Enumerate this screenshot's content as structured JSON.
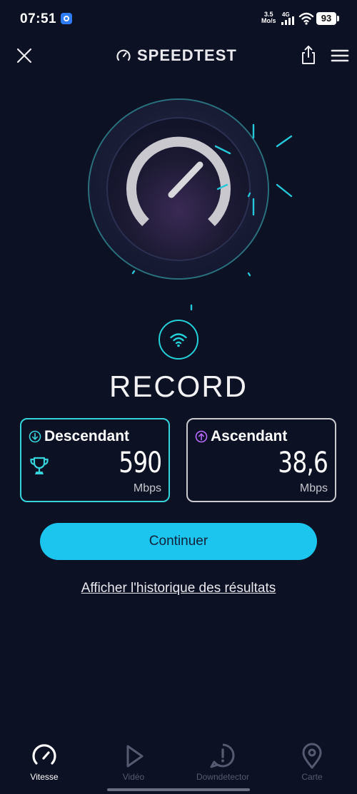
{
  "status_bar": {
    "time": "07:51",
    "net_speed_value": "3.5",
    "net_speed_unit": "Mo/s",
    "network": "4G",
    "battery": "93"
  },
  "header": {
    "title": "SPEEDTEST",
    "close_icon": "close-icon",
    "share_icon": "share-icon",
    "menu_icon": "menu-icon"
  },
  "result": {
    "title": "RECORD",
    "download": {
      "label": "Descendant",
      "value": "590",
      "unit": "Mbps",
      "color": "#35d4da"
    },
    "upload": {
      "label": "Ascendant",
      "value": "38,6",
      "unit": "Mbps",
      "color": "#b86bff"
    }
  },
  "actions": {
    "continue_label": "Continuer",
    "history_label": "Afficher l'historique des résultats"
  },
  "bottom_nav": {
    "items": [
      {
        "label": "Vitesse",
        "icon": "speedometer-icon",
        "active": true
      },
      {
        "label": "Vidéo",
        "icon": "play-icon",
        "active": false
      },
      {
        "label": "Downdetector",
        "icon": "alert-icon",
        "active": false
      },
      {
        "label": "Carte",
        "icon": "map-pin-icon",
        "active": false
      }
    ]
  },
  "colors": {
    "background": "#0d1124",
    "accent": "#1cc5ee",
    "download_accent": "#35d4da",
    "upload_accent": "#b86bff"
  }
}
